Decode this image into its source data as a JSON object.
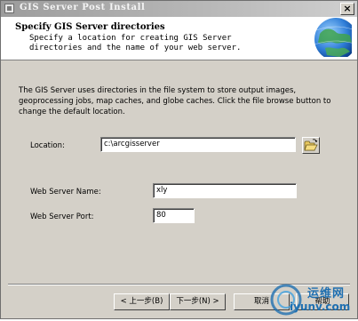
{
  "window": {
    "title": "GIS Server Post Install",
    "close_label": "×"
  },
  "header": {
    "title": "Specify GIS Server directories",
    "description": "Specify a location for creating GIS Server directories and the name of your web server."
  },
  "body": {
    "instructions": "The GIS Server uses directories in the file system to store output images, geoprocessing jobs, map caches, and globe caches.  Click the file browse button to change the default location."
  },
  "location": {
    "label": "Location:",
    "value": "c:\\arcgisserver"
  },
  "web_server_name": {
    "label": "Web Server Name:",
    "value": "xly"
  },
  "web_server_port": {
    "label": "Web Server Port:",
    "value": "80"
  },
  "buttons": {
    "back": "< 上一步(B)",
    "next": "下一步(N) >",
    "cancel": "取消",
    "help": "帮助"
  },
  "watermark": {
    "cn": "运维网",
    "url": "iyunv.com"
  },
  "icons": {
    "window": "app-icon",
    "browse": "open-folder-icon",
    "header": "globe-icon"
  }
}
